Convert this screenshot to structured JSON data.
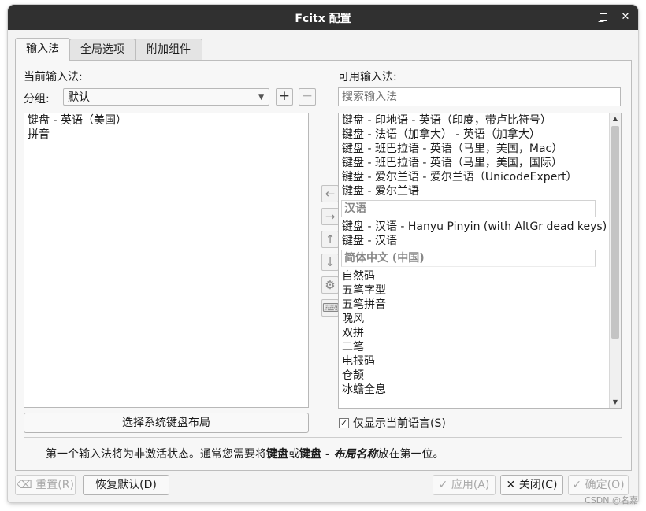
{
  "window": {
    "title": "Fcitx 配置",
    "minimize_glyph": "_",
    "maximize_glyph": "□",
    "close_glyph": "✕"
  },
  "tabs": [
    {
      "label": "输入法",
      "active": true
    },
    {
      "label": "全局选项",
      "active": false
    },
    {
      "label": "附加组件",
      "active": false
    }
  ],
  "left": {
    "heading": "当前输入法:",
    "group_label": "分组:",
    "group_value": "默认",
    "add_glyph": "+",
    "remove_glyph": "−",
    "items": [
      "键盘 - 英语（美国）",
      "拼音"
    ],
    "select_layout_button": "选择系统键盘布局"
  },
  "right": {
    "heading": "可用输入法:",
    "search_placeholder": "搜索输入法",
    "entries_a": [
      "键盘 - 印地语 - 英语（印度，带卢比符号）",
      "键盘 - 法语（加拿大） - 英语（加拿大）",
      "键盘 - 班巴拉语 - 英语（马里，美国，Mac）",
      "键盘 - 班巴拉语 - 英语（马里，美国，国际）",
      "键盘 - 爱尔兰语 - 爱尔兰语（UnicodeExpert）",
      "键盘 - 爱尔兰语"
    ],
    "group_1": "汉语",
    "entries_b": [
      "键盘 - 汉语 - Hanyu Pinyin (with AltGr dead keys)",
      "键盘 - 汉语"
    ],
    "group_2": "简体中文 (中国)",
    "entries_c": [
      "自然码",
      "五笔字型",
      "五笔拼音",
      "晚风",
      "双拼",
      "二笔",
      "电报码",
      "仓颉",
      "冰蟾全息"
    ],
    "only_current_language": "仅显示当前语言(S)",
    "only_current_language_checked": true
  },
  "side_buttons": [
    {
      "name": "move-left-icon",
      "glyph": "←"
    },
    {
      "name": "move-right-icon",
      "glyph": "→"
    },
    {
      "name": "move-up-icon",
      "glyph": "↑"
    },
    {
      "name": "move-down-icon",
      "glyph": "↓"
    },
    {
      "name": "gear-icon",
      "glyph": "⚙"
    },
    {
      "name": "keyboard-icon",
      "glyph": "⌨"
    }
  ],
  "hint": {
    "part1": "第一个输入法将为非激活状态。通常您需要将",
    "bold1": "键盘",
    "part2": "或",
    "bold2": "键盘 - ",
    "italic": "布局名称",
    "part3": "放在第一位。"
  },
  "footer": {
    "reset": "重置(R)",
    "restore_defaults": "恢复默认(D)",
    "apply": "应用(A)",
    "close": "关闭(C)",
    "ok": "确定(O)"
  },
  "watermark": "CSDN @名嘉"
}
